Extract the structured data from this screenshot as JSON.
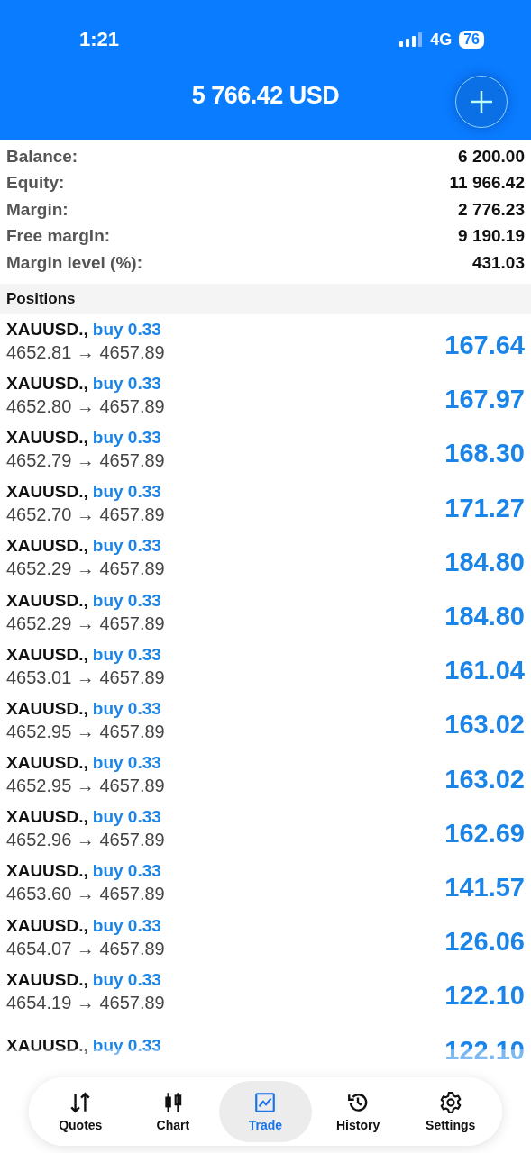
{
  "status_bar": {
    "time": "1:21",
    "network": "4G",
    "battery": "76"
  },
  "header": {
    "title": "5 766.42 USD"
  },
  "summary": [
    {
      "label": "Balance:",
      "value": "6 200.00"
    },
    {
      "label": "Equity:",
      "value": "11 966.42"
    },
    {
      "label": "Margin:",
      "value": "2 776.23"
    },
    {
      "label": "Free margin:",
      "value": "9 190.19"
    },
    {
      "label": "Margin level (%):",
      "value": "431.03"
    }
  ],
  "positions": {
    "title": "Positions",
    "rows": [
      {
        "symbol": "XAUUSD.,",
        "side": "buy 0.33",
        "prices": "4652.81 → 4657.89",
        "profit": "167.64"
      },
      {
        "symbol": "XAUUSD.,",
        "side": "buy 0.33",
        "prices": "4652.80 → 4657.89",
        "profit": "167.97"
      },
      {
        "symbol": "XAUUSD.,",
        "side": "buy 0.33",
        "prices": "4652.79 → 4657.89",
        "profit": "168.30"
      },
      {
        "symbol": "XAUUSD.,",
        "side": "buy 0.33",
        "prices": "4652.70 → 4657.89",
        "profit": "171.27"
      },
      {
        "symbol": "XAUUSD.,",
        "side": "buy 0.33",
        "prices": "4652.29 → 4657.89",
        "profit": "184.80"
      },
      {
        "symbol": "XAUUSD.,",
        "side": "buy 0.33",
        "prices": "4652.29 → 4657.89",
        "profit": "184.80"
      },
      {
        "symbol": "XAUUSD.,",
        "side": "buy 0.33",
        "prices": "4653.01 → 4657.89",
        "profit": "161.04"
      },
      {
        "symbol": "XAUUSD.,",
        "side": "buy 0.33",
        "prices": "4652.95 → 4657.89",
        "profit": "163.02"
      },
      {
        "symbol": "XAUUSD.,",
        "side": "buy 0.33",
        "prices": "4652.95 → 4657.89",
        "profit": "163.02"
      },
      {
        "symbol": "XAUUSD.,",
        "side": "buy 0.33",
        "prices": "4652.96 → 4657.89",
        "profit": "162.69"
      },
      {
        "symbol": "XAUUSD.,",
        "side": "buy 0.33",
        "prices": "4653.60 → 4657.89",
        "profit": "141.57"
      },
      {
        "symbol": "XAUUSD.,",
        "side": "buy 0.33",
        "prices": "4654.07 → 4657.89",
        "profit": "126.06"
      },
      {
        "symbol": "XAUUSD.,",
        "side": "buy 0.33",
        "prices": "4654.19 → 4657.89",
        "profit": "122.10"
      },
      {
        "symbol": "XAUUSD.,",
        "side": "buy 0.33",
        "profit": "122.10"
      }
    ]
  },
  "tab_bar": [
    {
      "label": "Quotes",
      "kind": "quotes",
      "selected": false
    },
    {
      "label": "Chart",
      "kind": "chart",
      "selected": false
    },
    {
      "label": "Trade",
      "kind": "trade",
      "selected": true
    },
    {
      "label": "History",
      "kind": "history",
      "selected": false
    },
    {
      "label": "Settings",
      "kind": "settings",
      "selected": false
    }
  ]
}
